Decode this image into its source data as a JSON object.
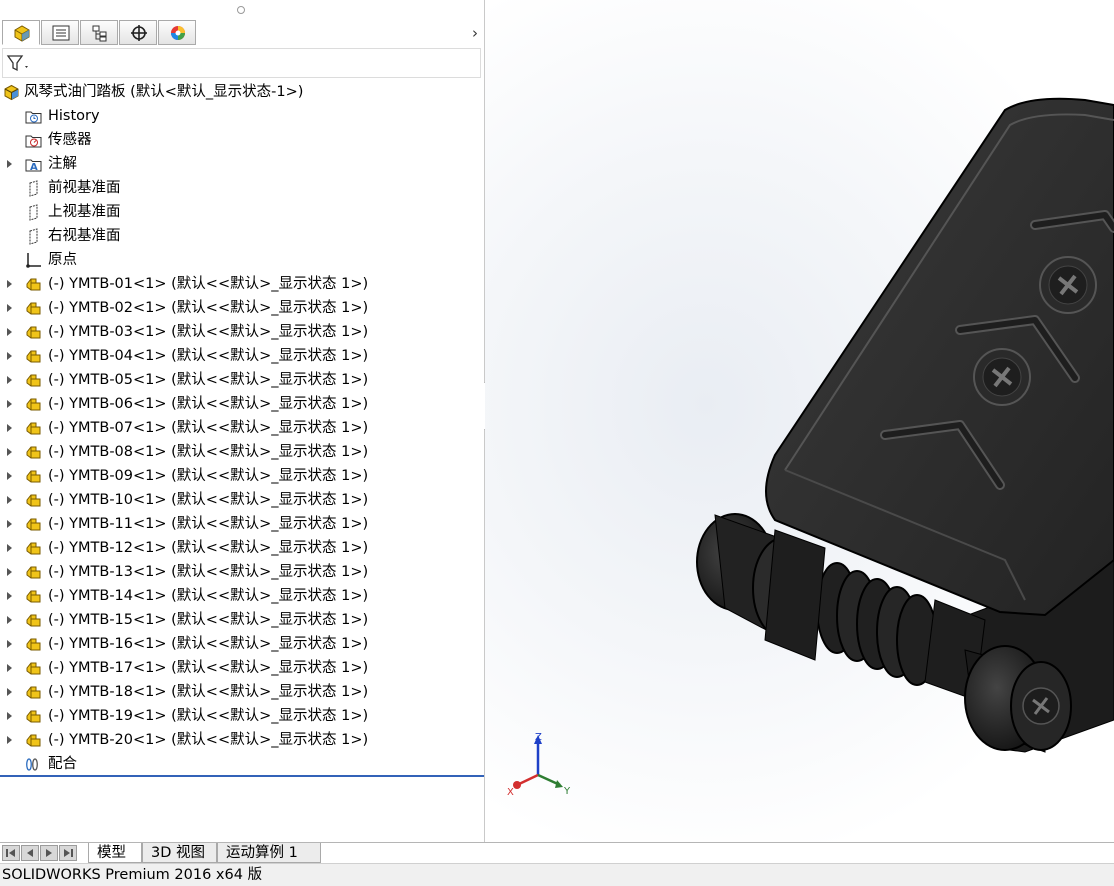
{
  "panel_tabs": [
    {
      "name": "featuremanager-tab-icon",
      "active": true
    },
    {
      "name": "propertymanager-tab-icon",
      "active": false
    },
    {
      "name": "configurationmanager-tab-icon",
      "active": false
    },
    {
      "name": "dimxpert-tab-icon",
      "active": false
    },
    {
      "name": "display-manager-tab-icon",
      "active": false
    }
  ],
  "tab_overflow_arrow": "›",
  "tree": {
    "root_label": "风琴式油门踏板  (默认<默认_显示状态-1>)",
    "fixed_items": [
      {
        "label": "History",
        "icon": "history-folder-icon",
        "expandable": false
      },
      {
        "label": "传感器",
        "icon": "sensors-folder-icon",
        "expandable": false
      },
      {
        "label": "注解",
        "icon": "annotations-folder-icon",
        "expandable": true
      },
      {
        "label": "前视基准面",
        "icon": "plane-icon",
        "expandable": false
      },
      {
        "label": "上视基准面",
        "icon": "plane-icon",
        "expandable": false
      },
      {
        "label": "右视基准面",
        "icon": "plane-icon",
        "expandable": false
      },
      {
        "label": "原点",
        "icon": "origin-icon",
        "expandable": false
      }
    ],
    "components": [
      "(-) YMTB-01<1> (默认<<默认>_显示状态 1>)",
      "(-) YMTB-02<1> (默认<<默认>_显示状态 1>)",
      "(-) YMTB-03<1> (默认<<默认>_显示状态 1>)",
      "(-) YMTB-04<1> (默认<<默认>_显示状态 1>)",
      "(-) YMTB-05<1> (默认<<默认>_显示状态 1>)",
      "(-) YMTB-06<1> (默认<<默认>_显示状态 1>)",
      "(-) YMTB-07<1> (默认<<默认>_显示状态 1>)",
      "(-) YMTB-08<1> (默认<<默认>_显示状态 1>)",
      "(-) YMTB-09<1> (默认<<默认>_显示状态 1>)",
      "(-) YMTB-10<1> (默认<<默认>_显示状态 1>)",
      "(-) YMTB-11<1> (默认<<默认>_显示状态 1>)",
      "(-) YMTB-12<1> (默认<<默认>_显示状态 1>)",
      "(-) YMTB-13<1> (默认<<默认>_显示状态 1>)",
      "(-) YMTB-14<1> (默认<<默认>_显示状态 1>)",
      "(-) YMTB-15<1> (默认<<默认>_显示状态 1>)",
      "(-) YMTB-16<1> (默认<<默认>_显示状态 1>)",
      "(-) YMTB-17<1> (默认<<默认>_显示状态 1>)",
      "(-) YMTB-18<1> (默认<<默认>_显示状态 1>)",
      "(-) YMTB-19<1> (默认<<默认>_显示状态 1>)",
      "(-) YMTB-20<1> (默认<<默认>_显示状态 1>)"
    ],
    "mates_label": "配合"
  },
  "triad": {
    "x": "X",
    "y": "Y",
    "z": "Z"
  },
  "bottom_tabs": [
    "模型",
    "3D 视图",
    "运动算例 1"
  ],
  "status_bar": "SOLIDWORKS Premium 2016 x64 版",
  "colors": {
    "component_icon": "#f0c419",
    "selection_line": "#3262b8",
    "model": "#2a2a2a"
  }
}
